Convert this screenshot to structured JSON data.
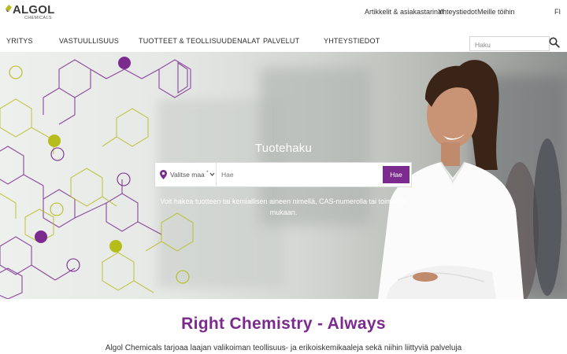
{
  "brand": {
    "name": "ALGOL",
    "sub": "CHEMICALS",
    "accent": "#7b2a8e",
    "lime": "#b5bd1a"
  },
  "toplinks": {
    "articles": "Artikkelit & asiakastarinat",
    "contact": "Yhteystiedot",
    "careers": "Meille töihin",
    "language": "FI"
  },
  "nav": {
    "items": [
      "YRITYS",
      "VASTUULLISUUS",
      "TUOTTEET & TEOLLISUUDENALAT",
      "PALVELUT",
      "YHTEYSTIEDOT"
    ],
    "search_placeholder": "Haku"
  },
  "hero": {
    "title": "Tuotehaku",
    "country_label": "Valitse maa",
    "country_marker": "*",
    "input_placeholder": "Hae",
    "button": "Hae",
    "description": "Voit hakea tuotteen tai kemiallisen aineen nimellä, CAS-numerolla tai toimialan mukaan."
  },
  "intro": {
    "tagline": "Right Chemistry - Always",
    "text": "Algol Chemicals tarjoaa laajan valikoiman teollisuus- ja erikoiskemikaaleja sekä niihin liittyviä palveluja"
  }
}
